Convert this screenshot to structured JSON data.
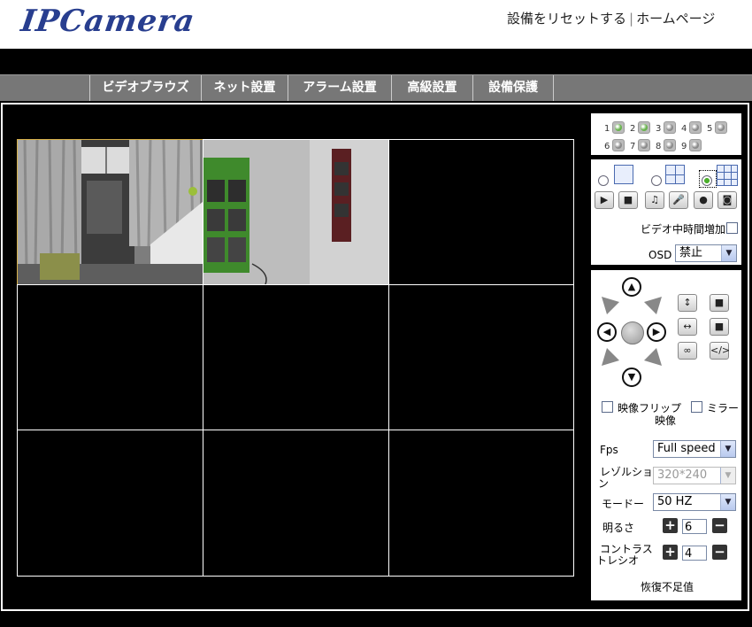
{
  "header": {
    "logo_text": "IPCamera",
    "reset_link": "設備をリセットする",
    "separator": "|",
    "home_link": "ホームページ"
  },
  "nav": {
    "items": [
      "ビデオブラウズ",
      "ネット設置",
      "アラーム設置",
      "高級設置",
      "設備保護"
    ]
  },
  "channels": {
    "labels": [
      "1",
      "2",
      "3",
      "4",
      "5",
      "6",
      "7",
      "8",
      "9"
    ],
    "active": [
      true,
      true,
      false,
      false,
      false,
      false,
      false,
      false,
      false
    ]
  },
  "view_controls": {
    "layout_selected": "9",
    "video_time_label": "ビデオ中時間増加",
    "osd_label": "OSD",
    "osd_value": "禁止"
  },
  "ptz": {
    "flip_label": "映像フリップ",
    "flip_label_line2": "映像",
    "mirror_label": "ミラー"
  },
  "settings": {
    "fps_label": "Fps",
    "fps_value": "Full speed",
    "resolution_label_line1": "レゾルショ",
    "resolution_label_line2": "ン",
    "resolution_value": "320*240",
    "mode_label": "モードー",
    "mode_value": "50 HZ",
    "brightness_label": "明るさ",
    "brightness_value": "6",
    "contrast_label_line1": "コントラス",
    "contrast_label_line2": "トレシオ",
    "contrast_value": "4",
    "restore_label": "恢復不足值"
  },
  "colors": {
    "logo": "#283e8f",
    "nav_bg": "#777777",
    "selected_border": "#d6b04a",
    "channel_active": "#66b24a"
  }
}
